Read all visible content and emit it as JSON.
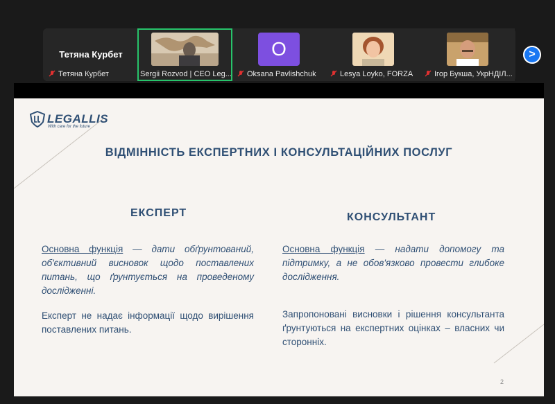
{
  "participants": [
    {
      "display_name": "Тетяна Курбет",
      "label": "Тетяна Курбет"
    },
    {
      "label": "Sergii Rozvod | CEO Leg..."
    },
    {
      "avatar_letter": "O",
      "label": "Oksana Pavlishchuk"
    },
    {
      "label": "Lesya Loyko, FORZA"
    },
    {
      "label": "Ігор Букша, УкрНДІЛ..."
    }
  ],
  "next_button": ">",
  "slide": {
    "logo": {
      "name": "LEGALLIS",
      "tagline": "With care for the future"
    },
    "title": "ВІДМІННІСТЬ ЕКСПЕРТНИХ І КОНСУЛЬТАЦІЙНИХ ПОСЛУГ",
    "left": {
      "heading": "ЕКСПЕРТ",
      "p1_label": "Основна функція",
      "p1_text": " — дати обґрунтований, об'єктивний висновок щодо поставлених питань, що ґрунтується на проведеному дослідженні.",
      "p2": "Експерт не надає інформації щодо вирішення поставлених питань."
    },
    "right": {
      "heading": "КОНСУЛЬТАНТ",
      "p1_label": "Основна функція",
      "p1_text": " — надати допомогу та підтримку, а не обов'язково провести глибоке дослідження.",
      "p2": "Запропоновані висновки і рішення консультанта ґрунтуються на експертних оцінках – власних чи сторонніх."
    },
    "page_number": "2"
  },
  "colors": {
    "accent": "#2f4f74",
    "active_border": "#27c46b",
    "button": "#1877f2",
    "avatar": "#7d4fe0"
  }
}
